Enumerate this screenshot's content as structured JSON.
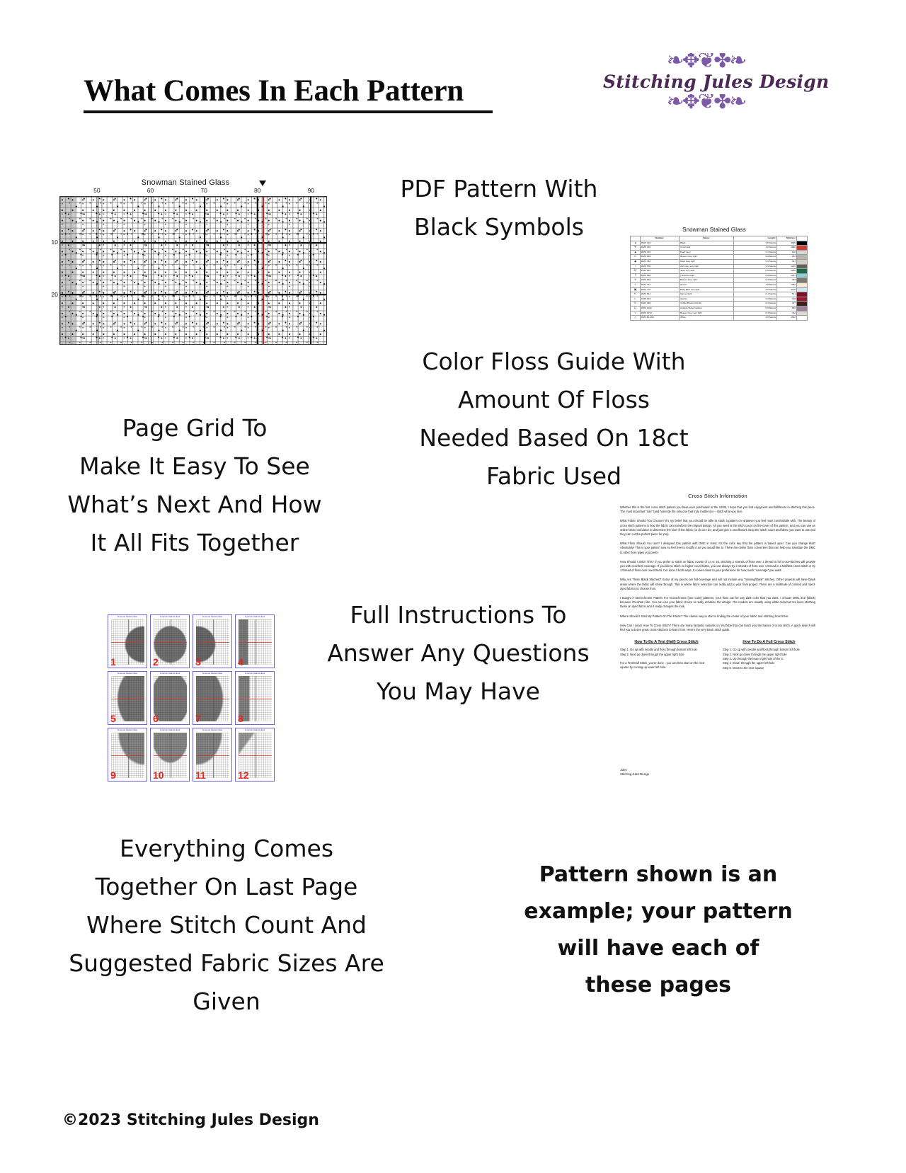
{
  "header": {
    "title": "What Comes In Each Pattern",
    "logo": {
      "wordmark": "Stitching Jules Design",
      "flourish_top": "❧✥❦✤❧",
      "flourish_bottom": "❧✥❦✤❧",
      "accent_color": "#7c5aa8",
      "wordmark_color": "#4a2a55"
    }
  },
  "captions": {
    "pdf_pattern": "PDF Pattern With\nBlack Symbols",
    "page_grid": "Page Grid To\nMake It Easy To See\nWhat’s Next And How\nIt All Fits Together",
    "floss_guide": "Color Floss Guide With\nAmount Of Floss\nNeeded Based On 18ct\nFabric Used",
    "instructions": "Full Instructions To\nAnswer Any Questions\nYou May Have",
    "last_page": "Everything Comes\nTogether On Last Page\nWhere Stitch Count And\nSuggested Fabric Sizes Are\nGiven",
    "disclaimer": "Pattern shown is an example; your pattern will have each of these pages"
  },
  "footer": {
    "copyright": "©2023 Stitching Jules Design"
  },
  "chart": {
    "title": "Snowman Stained Glass",
    "column_labels": [
      "50",
      "60",
      "70",
      "80",
      "90"
    ],
    "row_labels": [
      "10",
      "20"
    ],
    "center_line_color": "#e11b1b",
    "grid_color": "#3c3c3c"
  },
  "floss_table": {
    "title": "Snowman Stained Glass",
    "columns": [
      "",
      "Number:",
      "Name:",
      "Length:",
      "Stitches:",
      ""
    ],
    "rows": [
      {
        "symbol": "●",
        "number": "DMC    310",
        "name": "Black",
        "length": "3.5 Skeins",
        "stitches": "4999",
        "swatch": "#000000"
      },
      {
        "symbol": "✳",
        "number": "DMC    349",
        "name": "Coral dark",
        "length": "1.6 Skeins",
        "stitches": "1890",
        "swatch": "#cf3a34"
      },
      {
        "symbol": "▲",
        "number": "DMC    415",
        "name": "Pearl Grey",
        "length": "0.1 Skeins",
        "stitches": "160",
        "swatch": "#d4d6d8"
      },
      {
        "symbol": "C",
        "number": "DMC    648",
        "name": "Beaver Grey light",
        "length": "0.2 Skeins",
        "stitches": "250",
        "swatch": "#b9b4ae"
      },
      {
        "symbol": "◆",
        "number": "DMC    453",
        "name": "Shell Grey light",
        "length": "0.2 Skeins",
        "stitches": "321",
        "swatch": "#d6cdc6"
      },
      {
        "symbol": "I",
        "number": "DMC    535",
        "name": "Ash Grey very light",
        "length": "0.9 Skeins",
        "stitches": "1215",
        "swatch": "#62625e"
      },
      {
        "symbol": "JP",
        "number": "DMC    561",
        "name": "Jade very dark",
        "length": "0.9 Skeins",
        "stitches": "1230",
        "swatch": "#1d6b4a"
      },
      {
        "symbol": "T",
        "number": "DMC    598",
        "name": "Turquoise light",
        "length": "0.9 Skeins",
        "stitches": "1227",
        "swatch": "#8fcfd4"
      },
      {
        "symbol": "✕",
        "number": "DMC    646",
        "name": "Beaver Grey light",
        "length": "0.4 Skeins",
        "stitches": "493",
        "swatch": "#7d7a73"
      },
      {
        "symbol": "✧",
        "number": "DMC    712",
        "name": "Cream",
        "length": "1.0 Skeins",
        "stitches": "1382",
        "swatch": "#f3ead8"
      },
      {
        "symbol": "▣",
        "number": "DMC    775",
        "name": "Baby Blue very light",
        "length": "2.5 Skeins",
        "stitches": "3270",
        "swatch": "#d3e6f1"
      },
      {
        "symbol": "K",
        "number": "DMC    814",
        "name": "Garnet dark",
        "length": "0.4 Skeins",
        "stitches": "521",
        "swatch": "#7d1028"
      },
      {
        "symbol": "L",
        "number": "DMC    816",
        "name": "Garnet",
        "length": "0.2 Skeins",
        "stitches": "302",
        "swatch": "#9b1631"
      },
      {
        "symbol": "O",
        "number": "DMC    938",
        "name": "Coffee Brown ultra dk",
        "length": "0.3 Skeins",
        "stitches": "447",
        "swatch": "#3a241a"
      },
      {
        "symbol": "D",
        "number": "DMC   3041",
        "name": "Antique Violet medium",
        "length": "0.5 Skeins",
        "stitches": "583",
        "swatch": "#9a7f95"
      },
      {
        "symbol": ">",
        "number": "DMC   3072",
        "name": "Beaver Grey very light",
        "length": "0.3 Skeins",
        "stitches": "442",
        "swatch": "#dcdcd4"
      },
      {
        "symbol": "△",
        "number": "DMC  BLANC",
        "name": "White",
        "length": "2.0 Skeins",
        "stitches": "2622",
        "swatch": "#ffffff"
      }
    ]
  },
  "page_grid": {
    "page_numbers": [
      "1",
      "2",
      "3",
      "4",
      "5",
      "6",
      "7",
      "8",
      "9",
      "10",
      "11",
      "12"
    ],
    "mini_title": "Snowman Stained Glass",
    "border_color": "#6a63e0",
    "number_color": "#e8251c"
  },
  "instructions": {
    "title": "Cross Stitch Information",
    "paragraphs": [
      "Whether this is the first cross stitch pattern you have ever purchased or the 100th, I hope that you find enjoyment and fulfillment in stitching this piece. The most important “rule” (and honestly the only one that truly matters) is – stitch what you love.",
      "What Fabric Should You Choose? It’s my belief that you should be able to stitch a pattern on whatever you feel most comfortable with. The beauty of cross stitch patterns is how the fabric can transform the original design. All you need is the stitch count on the cover of this pattern, and you can use an online fabric calculator to determine the size of the fabric (or do as I do, and just give a needlework shop the stitch count and fabric you want to use and they can cut the perfect piece for you).",
      "What Floss Should You Use? I designed this pattern with DMC in mind. It’s the color key that the pattern is based upon. Can you change that? Absolutely! This is your pattern now so feel free to modify it as you would like to. There are online floss converters that can help you translate the DMC to other floss types you prefer.",
      "How Should I Stitch This? If you prefer to stitch on fabric counts of 14 or 18, stitching 2 strands of floss over 1 thread in full cross-stitches will provide you with excellent coverage. If you like to stitch on higher count fabric, you can always try 2 strands of floss over 1 thread in a half/tent cross-stitch or try 1 thread of floss over one thread. I’ve done it both ways. It comes down to your preference for how much “coverage” you want.",
      "Why Are There Blank Stitches? Some of my pieces are full-coverage and will not include any “missing/blank” stitches. Other projects will have blank areas where the fabric will show through. This is where fabric selection can really add to your final project. There are a multitude of colored and hand-dyed fabrics to choose from.",
      "I Bought A Monochrome Pattern For monochrome (one color) patterns, your floss can be any dark color that you want. I choose DMC 310 (black) because it’s what I like. You can use your fabric choice to really enhance the design. The models are usually using white Aida but I’ve been stitching these on dyed fabric and it really changes the look.",
      "Where Should I Start My Pattern On The Fabric? The classic way to start is finding the center of your fabric and stitching from there.",
      "How Can I Learn How To Cross Stitch? There are many fantastic tutorials on YouTube that can teach you the basics of cross stitch. A quick search will find you a dozen great cross-stitchers to learn from. Here’s the very basic stitch guide."
    ],
    "tent_stitch": {
      "heading": "How To Do A Tent (Half) Cross Stitch",
      "steps": [
        "Step 1. Go up with needle and floss through bottom left hole",
        "Step 2. Next go down through the upper right hole"
      ],
      "note": "For A Tent/Half Stitch, you’re done - you can then start on the next square by coming up lower left hole."
    },
    "full_stitch": {
      "heading": "How To Do A Full Cross Stitch",
      "steps": [
        "Step 1. Go up with needle and floss through bottom left hole",
        "Step 2. Next go down through the upper right hole",
        "Step 3. Up through the lower right hole of the X",
        "Step 4. Down through the upper left hole",
        "Step 5. Move to the next square"
      ]
    },
    "signature": "Jules\nStitching Jules Design"
  }
}
